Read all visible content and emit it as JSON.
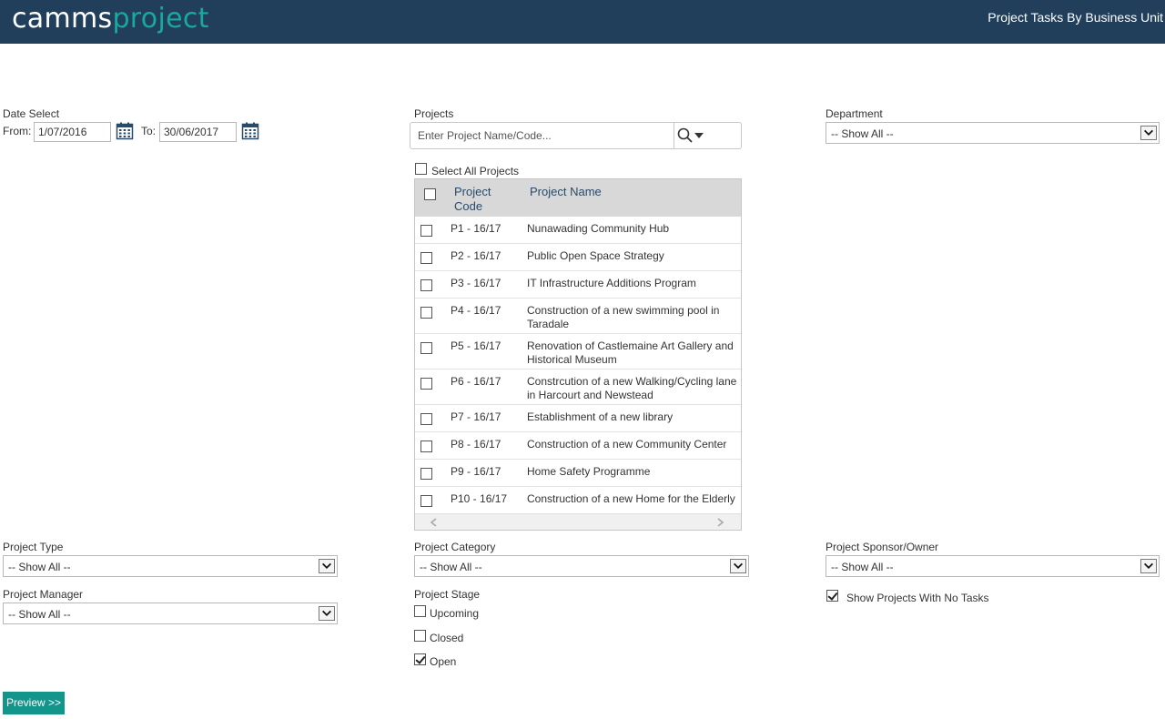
{
  "header": {
    "logo_part1": "camms",
    "logo_part2": "project",
    "page_title": "Project Tasks By Business Unit"
  },
  "date_select": {
    "label": "Date Select",
    "from_label": "From:",
    "from_value": "1/07/2016",
    "to_label": "To:",
    "to_value": "30/06/2017"
  },
  "projects": {
    "label": "Projects",
    "search_placeholder": "Enter Project Name/Code...",
    "select_all_label": "Select All Projects",
    "select_all_checked": false,
    "columns": [
      "Project Code",
      "Project Name"
    ],
    "rows": [
      {
        "code": "P1 - 16/17",
        "name": "Nunawading Community Hub",
        "checked": false
      },
      {
        "code": "P2 - 16/17",
        "name": "Public Open Space Strategy",
        "checked": false
      },
      {
        "code": "P3 - 16/17",
        "name": "IT Infrastructure Additions Program",
        "checked": false
      },
      {
        "code": "P4 - 16/17",
        "name": "Construction of a new swimming pool in Taradale",
        "checked": false
      },
      {
        "code": "P5 - 16/17",
        "name": "Renovation of Castlemaine Art Gallery and Historical Museum",
        "checked": false
      },
      {
        "code": "P6 - 16/17",
        "name": "Constrcution of a new Walking/Cycling lane in Harcourt and Newstead",
        "checked": false
      },
      {
        "code": "P7 - 16/17",
        "name": "Establishment of a new library",
        "checked": false
      },
      {
        "code": "P8 - 16/17",
        "name": "Construction of a new Community Center",
        "checked": false
      },
      {
        "code": "P9 - 16/17",
        "name": "Home Safety Programme",
        "checked": false
      },
      {
        "code": "P10 - 16/17",
        "name": "Construction of a new Home for the Elderly",
        "checked": false
      }
    ]
  },
  "department": {
    "label": "Department",
    "value": "-- Show All --"
  },
  "project_type": {
    "label": "Project Type",
    "value": "-- Show All --"
  },
  "project_category": {
    "label": "Project Category",
    "value": "-- Show All --"
  },
  "project_sponsor": {
    "label": "Project Sponsor/Owner",
    "value": "-- Show All --"
  },
  "project_manager": {
    "label": "Project Manager",
    "value": "-- Show All --"
  },
  "project_stage": {
    "label": "Project Stage",
    "options": [
      {
        "label": "Upcoming",
        "checked": false
      },
      {
        "label": "Closed",
        "checked": false
      },
      {
        "label": "Open",
        "checked": true
      }
    ]
  },
  "no_tasks": {
    "label": "Show Projects With No Tasks",
    "checked": true
  },
  "preview_button": "Preview >>",
  "icons": {
    "calendar": "calendar-icon",
    "search": "search-icon",
    "dropdown": "chevron-down-icon",
    "scroll_left": "chevron-left-icon",
    "scroll_right": "chevron-right-icon"
  },
  "colors": {
    "header_bg": "#213f5b",
    "logo_accent": "#19a99c",
    "button_bg": "#13958b",
    "grid_header_bg": "#d8d8d8"
  }
}
